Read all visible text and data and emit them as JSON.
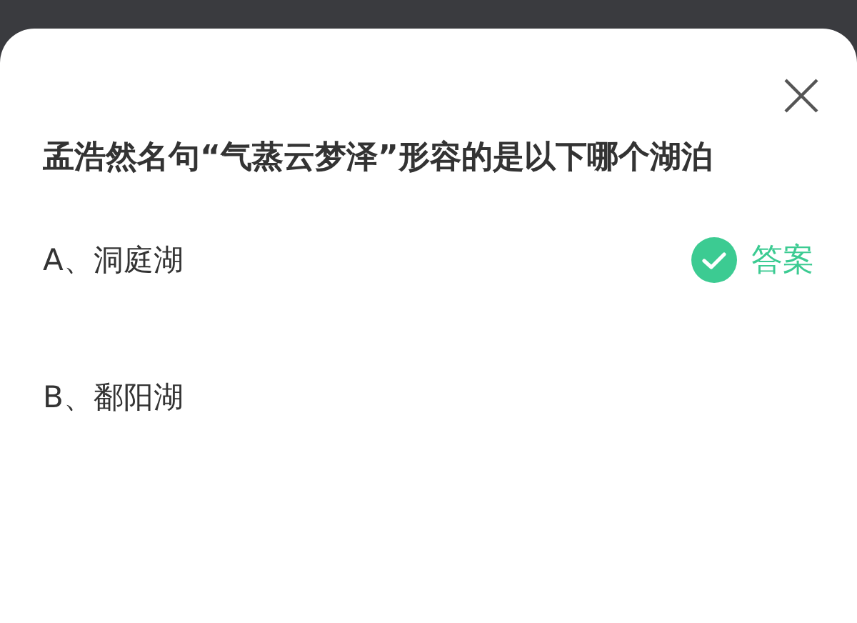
{
  "question": "孟浩然名句“气蒸云梦泽”形容的是以下哪个湖泊",
  "answer_label": "答案",
  "options": [
    {
      "label": "A、洞庭湖",
      "correct": true
    },
    {
      "label": "B、鄱阳湖",
      "correct": false
    }
  ]
}
